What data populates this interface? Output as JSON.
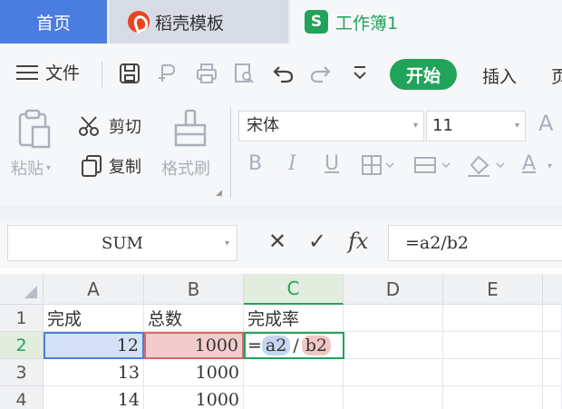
{
  "tabs": {
    "home": "首页",
    "docer": "稻壳模板",
    "workbook": "工作簿1",
    "workbook_logo": "S"
  },
  "menu": {
    "file": "文件",
    "start": "开始",
    "insert": "插入",
    "extra": "页"
  },
  "ribbon": {
    "paste": "粘贴",
    "cut": "剪切",
    "copy": "复制",
    "format_painter": "格式刷",
    "font_name": "宋体",
    "font_size": "11"
  },
  "formula_bar": {
    "name_box": "SUM",
    "formula": "=a2/b2"
  },
  "sheet": {
    "columns": [
      "A",
      "B",
      "C",
      "D",
      "E"
    ],
    "rows": [
      "1",
      "2",
      "3",
      "4"
    ],
    "cells": {
      "A1": "完成",
      "B1": "总数",
      "C1": "完成率",
      "A2": "12",
      "B2": "1000",
      "A3": "13",
      "B3": "1000",
      "A4": "14",
      "B4": "1000"
    },
    "editing": {
      "eq": "=",
      "ref_a": "a2",
      "op": "/",
      "ref_b": "b2"
    }
  },
  "colors": {
    "accent_green": "#22a35a",
    "tab_blue": "#4b7ce0",
    "ref_blue": "#4a7fd6",
    "ref_red": "#d46a6a"
  }
}
